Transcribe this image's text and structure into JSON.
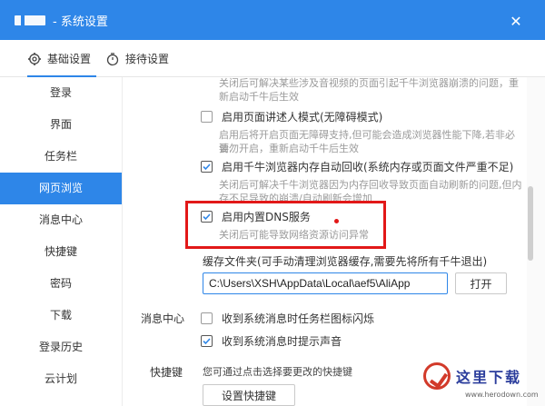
{
  "window": {
    "title": "- 系统设置",
    "close_glyph": "✕"
  },
  "tabs": [
    {
      "label": "基础设置",
      "icon": "gear-icon",
      "active": true
    },
    {
      "label": "接待设置",
      "icon": "timer-icon",
      "active": false
    }
  ],
  "sidebar": {
    "items": [
      {
        "label": "登录"
      },
      {
        "label": "界面"
      },
      {
        "label": "任务栏"
      },
      {
        "label": "网页浏览",
        "active": true
      },
      {
        "label": "消息中心"
      },
      {
        "label": "快捷键"
      },
      {
        "label": "密码"
      },
      {
        "label": "下载"
      },
      {
        "label": "登录历史"
      },
      {
        "label": "云计划"
      }
    ]
  },
  "content": {
    "top_desc_line1": "关闭后可解决某些涉及音视频的页面引起千牛浏览器崩溃的问题，重",
    "top_desc_line2": "新启动千牛后生效",
    "narrator": {
      "label": "启用页面讲述人模式(无障碍模式)",
      "checked": false,
      "desc_line1": "启用后将开启页面无障碍支持,但可能会造成浏览器性能下降,若非必要,",
      "desc_line2": "请勿开启，重新启动千牛后生效"
    },
    "auto_recycle": {
      "label": "启用千牛浏览器内存自动回收(系统内存或页面文件严重不足)",
      "checked": true,
      "desc_line1": "关闭后可解决千牛浏览器因为内存回收导致页面自动刷新的问题,但内",
      "desc_line2": "存不足导致的崩溃/自动刷新会增加"
    },
    "builtin_dns": {
      "label": "启用内置DNS服务",
      "checked": true,
      "desc": "关闭后可能导致网络资源访问异常"
    },
    "cache": {
      "label": "缓存文件夹(可手动清理浏览器缓存,需要先将所有千牛退出)",
      "path_value": "C:\\Users\\XSH\\AppData\\Local\\aef5\\AliApp",
      "open_button": "打开"
    },
    "message_center": {
      "section_label": "消息中心",
      "opt1_label": "收到系统消息时任务栏图标闪烁",
      "opt1_checked": false,
      "opt2_label": "收到系统消息时提示声音",
      "opt2_checked": true
    },
    "shortcut": {
      "section_label": "快捷键",
      "desc": "您可通过点击选择要更改的快捷键",
      "button": "设置快捷键"
    }
  },
  "watermark": {
    "text": "这里下载",
    "url": "www.herodown.com"
  },
  "colors": {
    "accent": "#2e86e8",
    "highlight": "#e21818"
  }
}
